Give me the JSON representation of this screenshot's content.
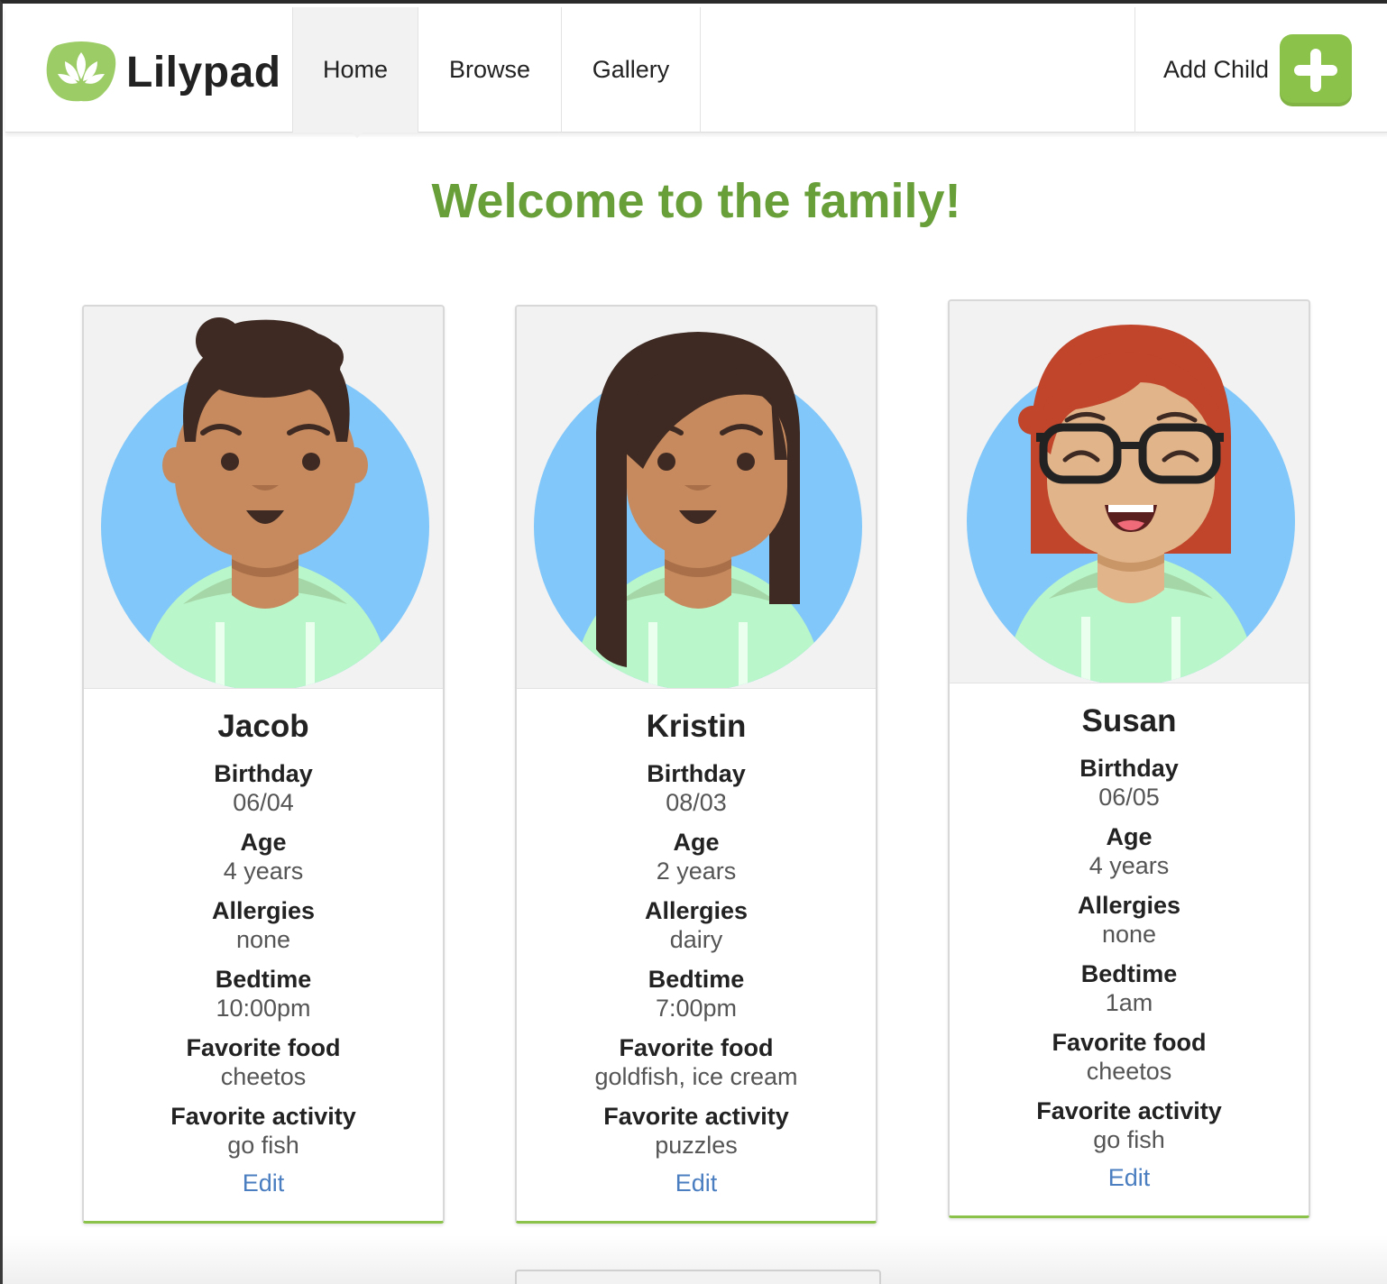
{
  "brand": {
    "name": "Lilypad"
  },
  "nav": {
    "items": [
      {
        "label": "Home",
        "active": true
      },
      {
        "label": "Browse",
        "active": false
      },
      {
        "label": "Gallery",
        "active": false
      }
    ],
    "add_child_label": "Add Child"
  },
  "page": {
    "heading": "Welcome to the family!"
  },
  "colors": {
    "accent_green": "#8bc34a",
    "heading_green": "#689f38",
    "link_blue": "#4a7ec0",
    "avatar_bg": "#81c7f9"
  },
  "children": [
    {
      "name": "Jacob",
      "fields": [
        {
          "label": "Birthday",
          "value": "06/04"
        },
        {
          "label": "Age",
          "value": "4 years"
        },
        {
          "label": "Allergies",
          "value": "none"
        },
        {
          "label": "Bedtime",
          "value": "10:00pm"
        },
        {
          "label": "Favorite food",
          "value": "cheetos"
        },
        {
          "label": "Favorite activity",
          "value": "go fish"
        }
      ],
      "edit_label": "Edit",
      "avatar_icon": "boy-avatar-icon"
    },
    {
      "name": "Kristin",
      "fields": [
        {
          "label": "Birthday",
          "value": "08/03"
        },
        {
          "label": "Age",
          "value": "2 years"
        },
        {
          "label": "Allergies",
          "value": "dairy"
        },
        {
          "label": "Bedtime",
          "value": "7:00pm"
        },
        {
          "label": "Favorite food",
          "value": "goldfish, ice cream"
        },
        {
          "label": "Favorite activity",
          "value": "puzzles"
        }
      ],
      "edit_label": "Edit",
      "avatar_icon": "girl-long-hair-avatar-icon"
    },
    {
      "name": "Susan",
      "fields": [
        {
          "label": "Birthday",
          "value": "06/05"
        },
        {
          "label": "Age",
          "value": "4 years"
        },
        {
          "label": "Allergies",
          "value": "none"
        },
        {
          "label": "Bedtime",
          "value": "1am"
        },
        {
          "label": "Favorite food",
          "value": "cheetos"
        },
        {
          "label": "Favorite activity",
          "value": "go fish"
        }
      ],
      "edit_label": "Edit",
      "avatar_icon": "girl-glasses-avatar-icon"
    }
  ]
}
